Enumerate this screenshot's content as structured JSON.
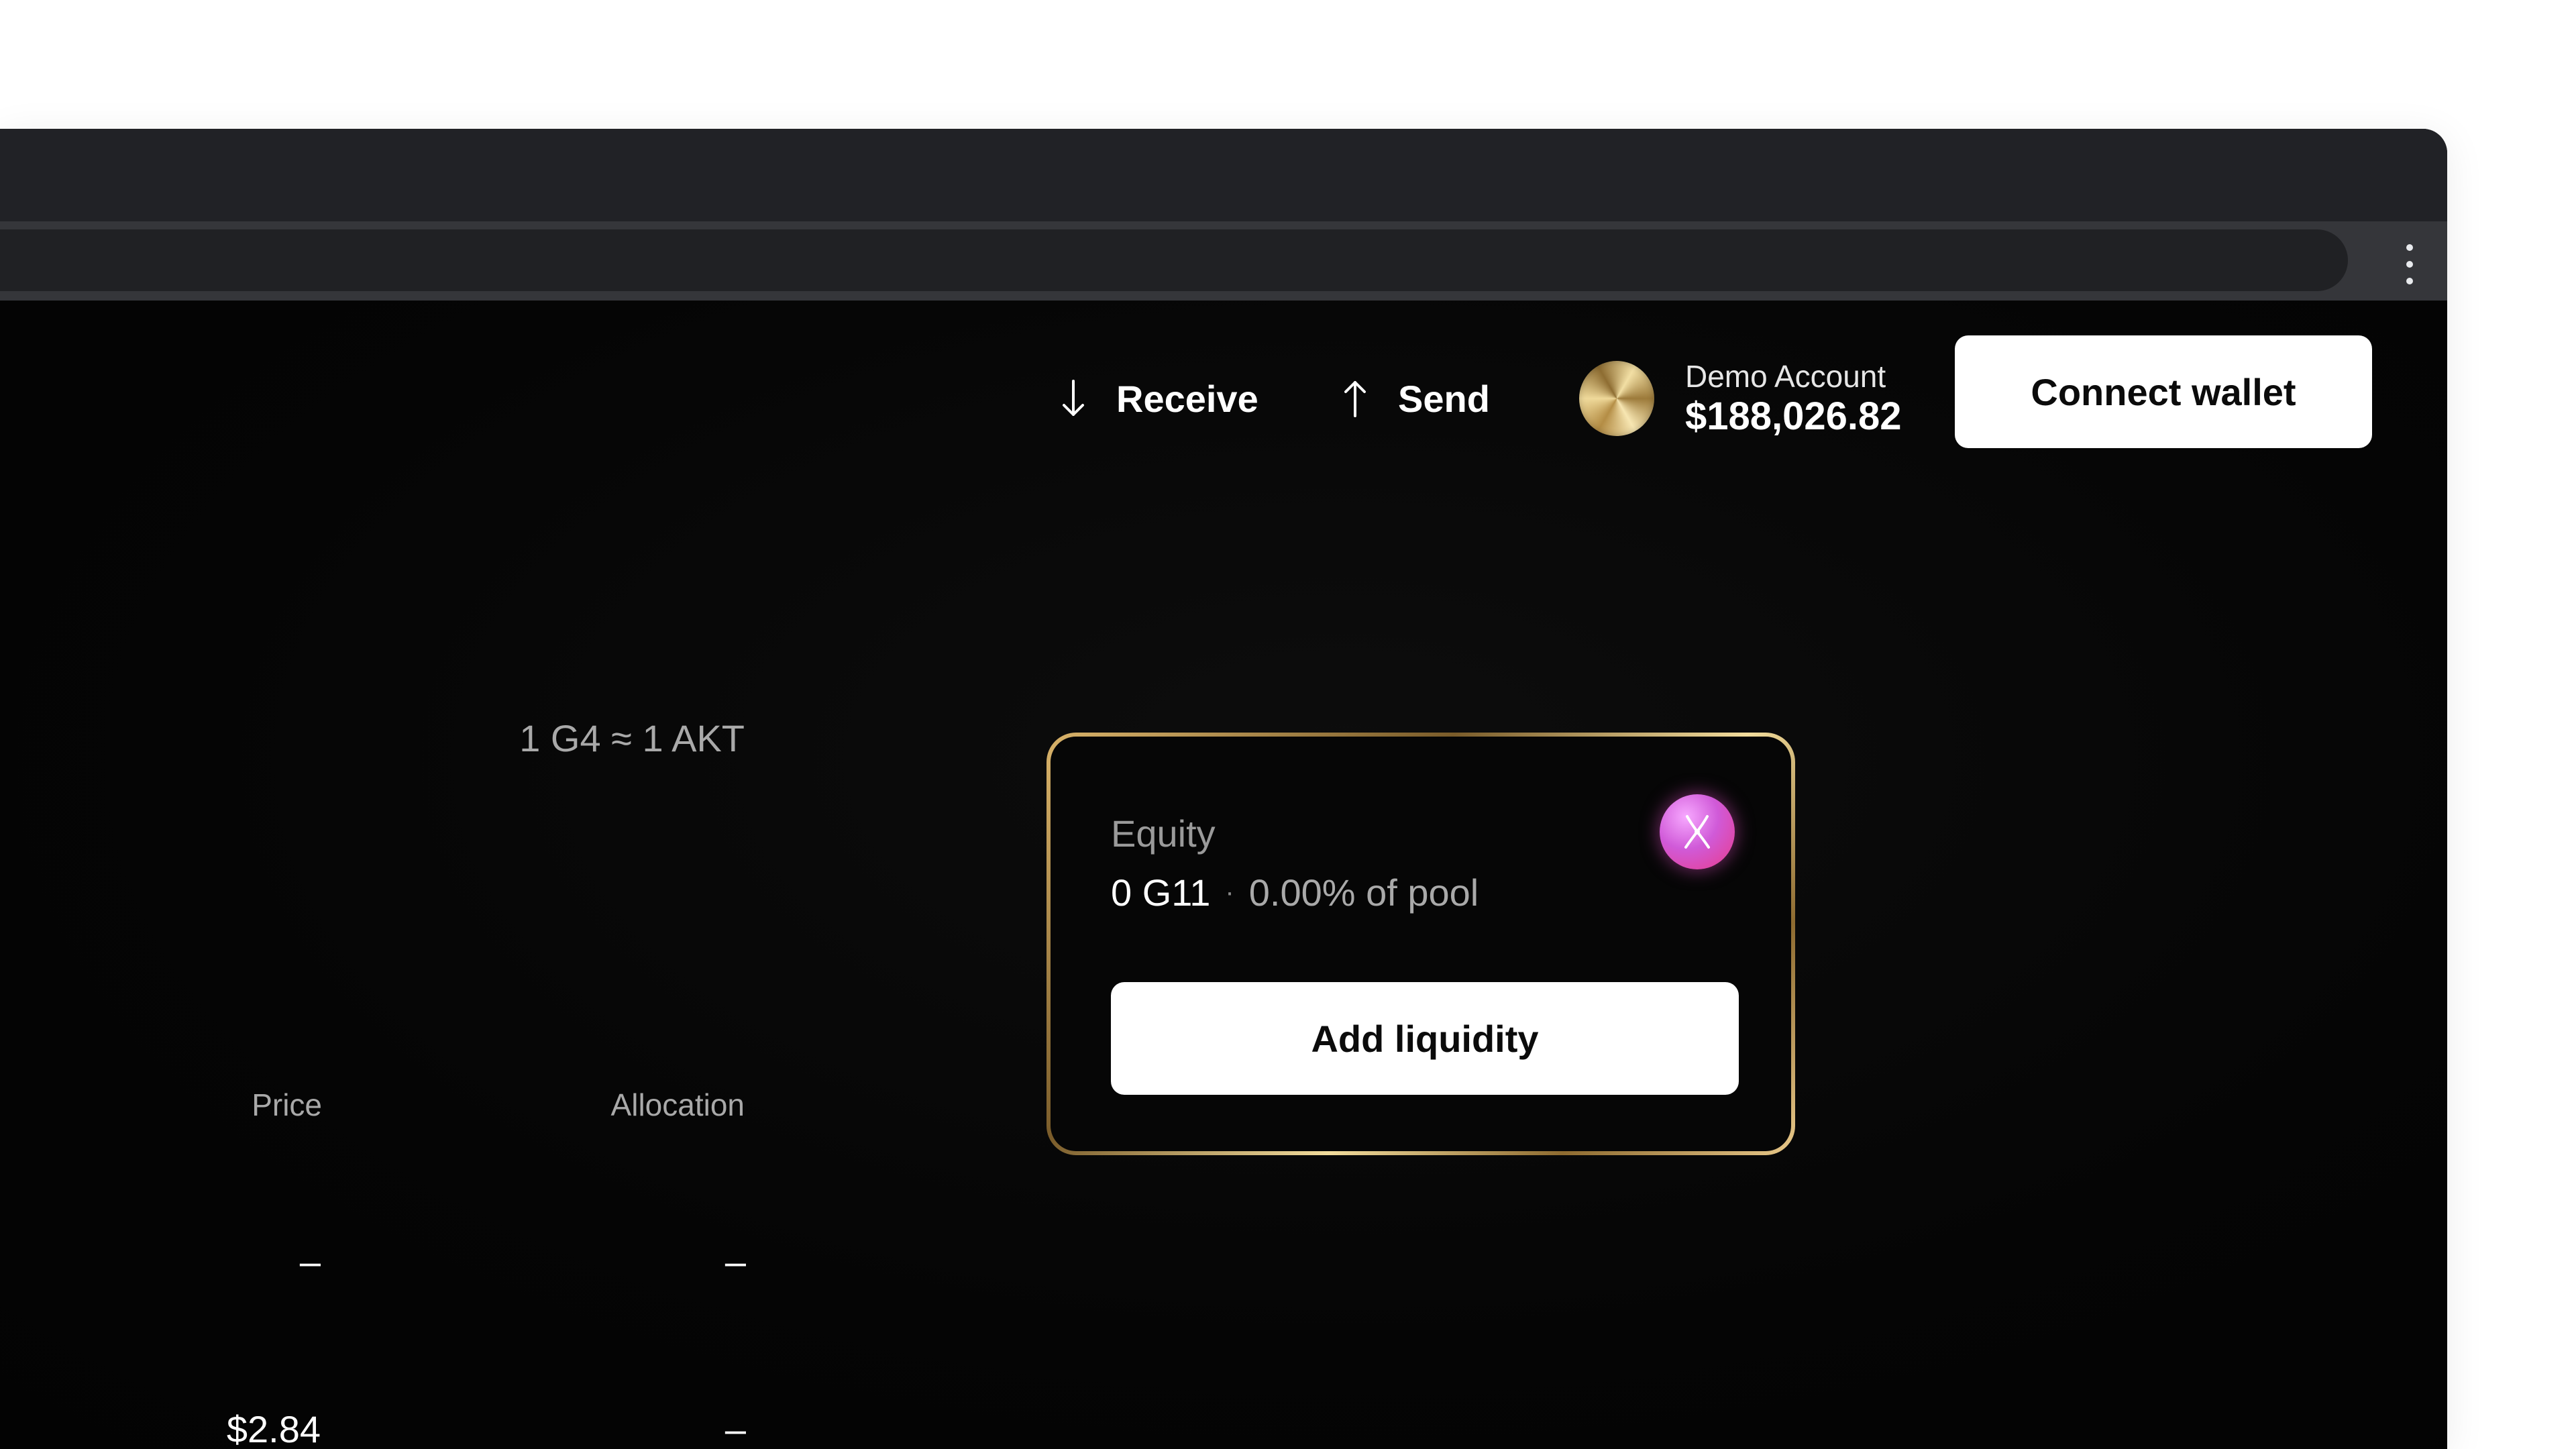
{
  "header": {
    "receive_label": "Receive",
    "send_label": "Send",
    "account_label": "Demo Account",
    "account_balance": "$188,026.82",
    "connect_wallet_label": "Connect wallet"
  },
  "rate": "1 G4 ≈ 1 AKT",
  "equity": {
    "label": "Equity",
    "amount": "0 G11",
    "separator": "·",
    "pool_share": "0.00% of pool",
    "add_liquidity_label": "Add liquidity",
    "token_icon": "token-x-icon"
  },
  "table": {
    "columns": [
      "Price",
      "Allocation"
    ],
    "rows": [
      {
        "price": "–",
        "allocation": "–"
      },
      {
        "price": "$2.84",
        "allocation": "–"
      }
    ]
  },
  "colors": {
    "background": "#040404",
    "gold_border": "#d9b36a",
    "token_pink": "#e93b8a"
  }
}
